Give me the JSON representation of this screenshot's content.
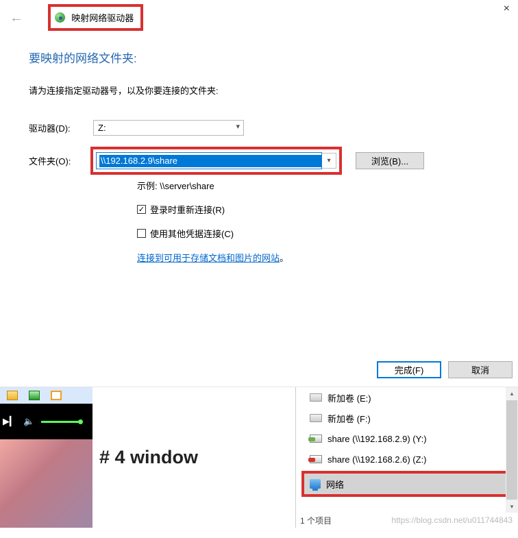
{
  "dialog": {
    "title": "映射网络驱动器",
    "heading": "要映射的网络文件夹:",
    "instruction": "请为连接指定驱动器号，以及你要连接的文件夹:",
    "drive_label": "驱动器(D):",
    "drive_value": "Z:",
    "folder_label": "文件夹(O):",
    "folder_value": "\\\\192.168.2.9\\share",
    "browse_label": "浏览(B)...",
    "example": "示例: \\\\server\\share",
    "reconnect_label": "登录时重新连接(R)",
    "other_cred_label": "使用其他凭据连接(C)",
    "website_link": "连接到可用于存储文档和图片的网站",
    "website_period": "。",
    "finish_label": "完成(F)",
    "cancel_label": "取消"
  },
  "bottom": {
    "section_title": "# 4 window",
    "tree_items": [
      {
        "icon": "drive",
        "label": "新加卷 (E:)"
      },
      {
        "icon": "drive",
        "label": "新加卷 (F:)"
      },
      {
        "icon": "share",
        "label": "share (\\\\192.168.2.9) (Y:)"
      },
      {
        "icon": "share-x",
        "label": "share (\\\\192.168.2.6) (Z:)"
      }
    ],
    "network_label": "网络",
    "status": "1 个项目",
    "watermark": "https://blog.csdn.net/u011744843"
  }
}
